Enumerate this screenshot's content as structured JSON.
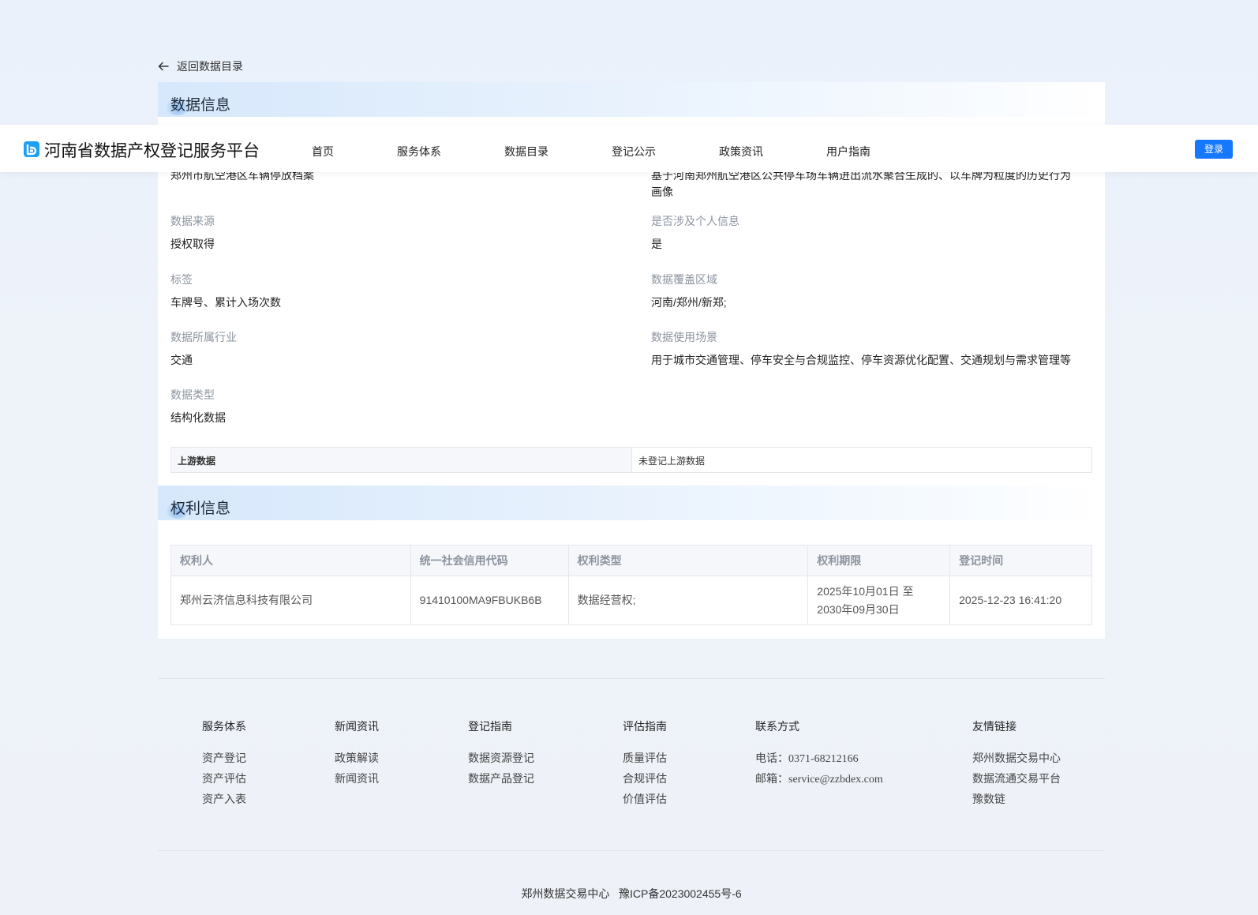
{
  "back": {
    "label": "返回数据目录"
  },
  "header": {
    "brand": "河南省数据产权登记服务平台",
    "nav": [
      "首页",
      "服务体系",
      "数据目录",
      "登记公示",
      "政策资讯",
      "用户指南"
    ],
    "login": "登录"
  },
  "data_info": {
    "title": "数据信息",
    "partial_left": "郑州市航空港区车辆停放档案",
    "partial_right_1": "基于河南郑州航空港区公共停车场车辆进出流水聚合生成的、以车牌为粒度的历史行为",
    "partial_right_2": "画像",
    "fields": [
      {
        "key": "数据来源",
        "value": "授权取得"
      },
      {
        "key": "是否涉及个人信息",
        "value": "是"
      },
      {
        "key": "标签",
        "value": "车牌号、累计入场次数"
      },
      {
        "key": "数据覆盖区域",
        "value": "河南/郑州/新郑;"
      },
      {
        "key": "数据所属行业",
        "value": "交通"
      },
      {
        "key": "数据使用场景",
        "value": "用于城市交通管理、停车安全与合规监控、停车资源优化配置、交通规划与需求管理等"
      },
      {
        "key": "数据类型",
        "value": "结构化数据"
      }
    ],
    "upstream": {
      "key": "上游数据",
      "value": "未登记上游数据"
    }
  },
  "rights_info": {
    "title": "权利信息",
    "columns": [
      "权利人",
      "统一社会信用代码",
      "权利类型",
      "权利期限",
      "登记时间"
    ],
    "row": {
      "holder": "郑州云济信息科技有限公司",
      "code": "91410100MA9FBUKB6B",
      "type": "数据经营权;",
      "period_1": "2025年10月01日 至",
      "period_2": "2030年09月30日",
      "time": "2025-12-23 16:41:20"
    }
  },
  "footer": {
    "columns": [
      {
        "title": "服务体系",
        "items": [
          "资产登记",
          "资产评估",
          "资产入表"
        ]
      },
      {
        "title": "新闻资讯",
        "items": [
          "政策解读",
          "新闻资讯"
        ]
      },
      {
        "title": "登记指南",
        "items": [
          "数据资源登记",
          "数据产品登记"
        ]
      },
      {
        "title": "评估指南",
        "items": [
          "质量评估",
          "合规评估",
          "价值评估"
        ]
      },
      {
        "title": "联系方式",
        "phone_label": "电话：",
        "phone": "0371-68212166",
        "email_label": "邮箱：",
        "email": "service@zzbdex.com"
      },
      {
        "title": "友情链接",
        "items": [
          "郑州数据交易中心",
          "数据流通交易平台",
          "豫数链"
        ]
      }
    ],
    "copyright": "郑州数据交易中心   豫ICP备2023002455号-6"
  },
  "colors": {
    "accent": "#1677ff",
    "background": "#eef3fa",
    "muted_label": "#8c94a0"
  }
}
